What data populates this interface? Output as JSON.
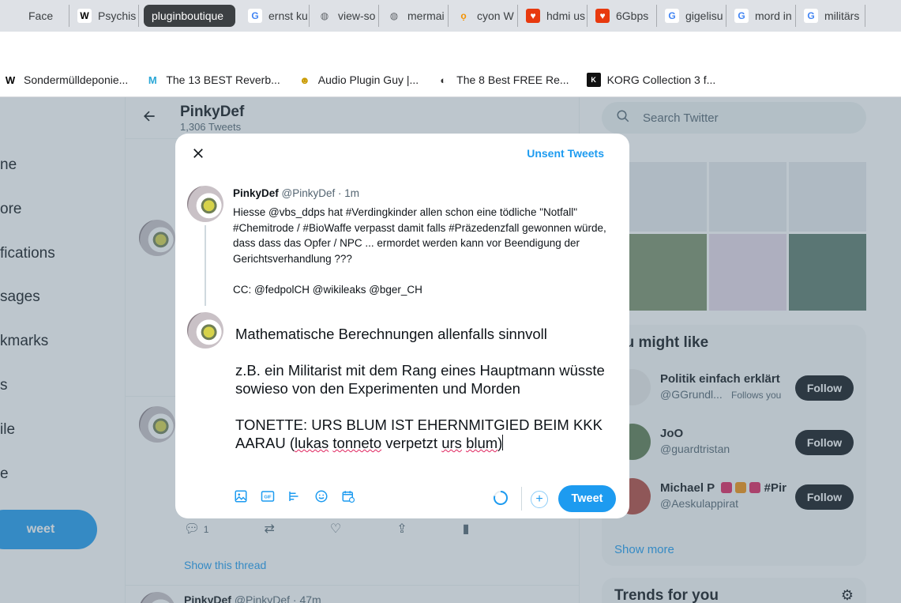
{
  "browser": {
    "tabs": [
      {
        "label": "Face",
        "icon": "facebook-icon",
        "fav_text": "",
        "fav_bg": "#dee1e6",
        "fav_color": "#3c4043"
      },
      {
        "label": "Psychis",
        "icon": "wikipedia-icon",
        "fav_text": "W",
        "fav_bg": "#ffffff",
        "fav_color": "#000000"
      },
      {
        "label": "pluginboutique",
        "icon": "",
        "active": true
      },
      {
        "label": "ernst ku",
        "icon": "google-icon",
        "fav_text": "G",
        "fav_bg": "#ffffff",
        "fav_color": "#4285f4"
      },
      {
        "label": "view-so",
        "icon": "globe-icon",
        "fav_text": "◍",
        "fav_bg": "#dee1e6",
        "fav_color": "#5f6368"
      },
      {
        "label": "mermai",
        "icon": "globe-icon",
        "fav_text": "◍",
        "fav_bg": "#dee1e6",
        "fav_color": "#5f6368"
      },
      {
        "label": "cyon W",
        "icon": "cyon-icon",
        "fav_text": "ọ",
        "fav_bg": "#dee1e6",
        "fav_color": "#f39200"
      },
      {
        "label": "hdmi us",
        "icon": "shop-icon",
        "fav_text": "♥",
        "fav_bg": "#e8390e",
        "fav_color": "#ffffff"
      },
      {
        "label": "6Gbps",
        "icon": "shop-icon",
        "fav_text": "♥",
        "fav_bg": "#e8390e",
        "fav_color": "#ffffff"
      },
      {
        "label": "gigelisu",
        "icon": "google-icon",
        "fav_text": "G",
        "fav_bg": "#ffffff",
        "fav_color": "#4285f4"
      },
      {
        "label": "mord in",
        "icon": "google-icon",
        "fav_text": "G",
        "fav_bg": "#ffffff",
        "fav_color": "#4285f4"
      },
      {
        "label": "militärs",
        "icon": "google-icon",
        "fav_text": "G",
        "fav_bg": "#ffffff",
        "fav_color": "#4285f4"
      }
    ],
    "bookmarks": [
      {
        "label": "Sondermülldeponie...",
        "icon": "wikipedia-icon",
        "fav_text": "W",
        "fav_color": "#000000"
      },
      {
        "label": "The 13 BEST Reverb...",
        "icon": "m-logo-icon",
        "fav_text": "M",
        "fav_color": "#2aa7d6"
      },
      {
        "label": "Audio Plugin Guy |...",
        "icon": "plugin-guy-icon",
        "fav_text": "☻",
        "fav_color": "#c99a00"
      },
      {
        "label": "The 8 Best FREE Re...",
        "icon": "half-circle-icon",
        "fav_text": "◐",
        "fav_color": "#333333"
      },
      {
        "label": "KORG Collection 3 f...",
        "icon": "korg-icon",
        "fav_text": "K",
        "fav_color": "#ffffff"
      }
    ]
  },
  "sidebar": {
    "items": [
      "ne",
      "ore",
      "fications",
      "sages",
      "kmarks",
      "s",
      "ile",
      "e"
    ],
    "tweet_button": "weet"
  },
  "profile": {
    "name": "PinkyDef",
    "tweet_count": "1,306 Tweets"
  },
  "timeline": {
    "reply_count": "1",
    "show_thread": "Show this thread",
    "next_tweet_name": "PinkyDef",
    "next_tweet_meta": "@PinkyDef · 47m"
  },
  "right": {
    "search_placeholder": "Search Twitter",
    "who_to_follow_title": "ou might like",
    "suggestions": [
      {
        "name": "Politik einfach erklärt",
        "handle": "@GGrundl...",
        "follows_you": "Follows you",
        "button": "Follow",
        "avatar_color": "#e9e9e9"
      },
      {
        "name": "JoO",
        "handle": "@guardtristan",
        "follows_you": "",
        "button": "Follow",
        "avatar_color": "#5c7a4f"
      },
      {
        "name": "Michael P",
        "name_suffix": "#Pir",
        "handle": "@Aeskulappirat",
        "follows_you": "",
        "button": "Follow",
        "avatar_color": "#b3463d"
      }
    ],
    "show_more": "Show more",
    "trends_title": "Trends for you"
  },
  "modal": {
    "unsent_label": "Unsent Tweets",
    "original": {
      "name": "PinkyDef",
      "meta": "@PinkyDef · 1m",
      "text": "Hiesse @vbs_ddps hat #Verdingkinder allen schon eine tödliche \"Notfall\" #Chemitrode / #BioWaffe verpasst damit falls #Präzedenzfall gewonnen würde, dass dass das Opfer / NPC ... ermordet werden kann vor Beendigung der Gerichtsverhandlung ???\n\nCC: @fedpolCH @wikileaks @bger_CH"
    },
    "draft": {
      "line1": "Mathematische Berechnungen allenfalls sinnvoll",
      "line2": "z.B. ein Militarist mit dem Rang eines Hauptmann wüsste sowieso von den Experimenten und Morden",
      "line3_prefix": "TONETTE: URS BLUM IST EHERNMITGIED BEIM KKK AARAU (",
      "word_lukas": "lukas",
      "word_tonneto": "tonneto",
      "mid": "verpetzt",
      "word_urs": "urs",
      "word_blum": "blum",
      "suffix": ")"
    },
    "tweet_button": "Tweet"
  },
  "colors": {
    "accent": "#1d9bf0",
    "text": "#0f1419",
    "muted": "#536471"
  }
}
